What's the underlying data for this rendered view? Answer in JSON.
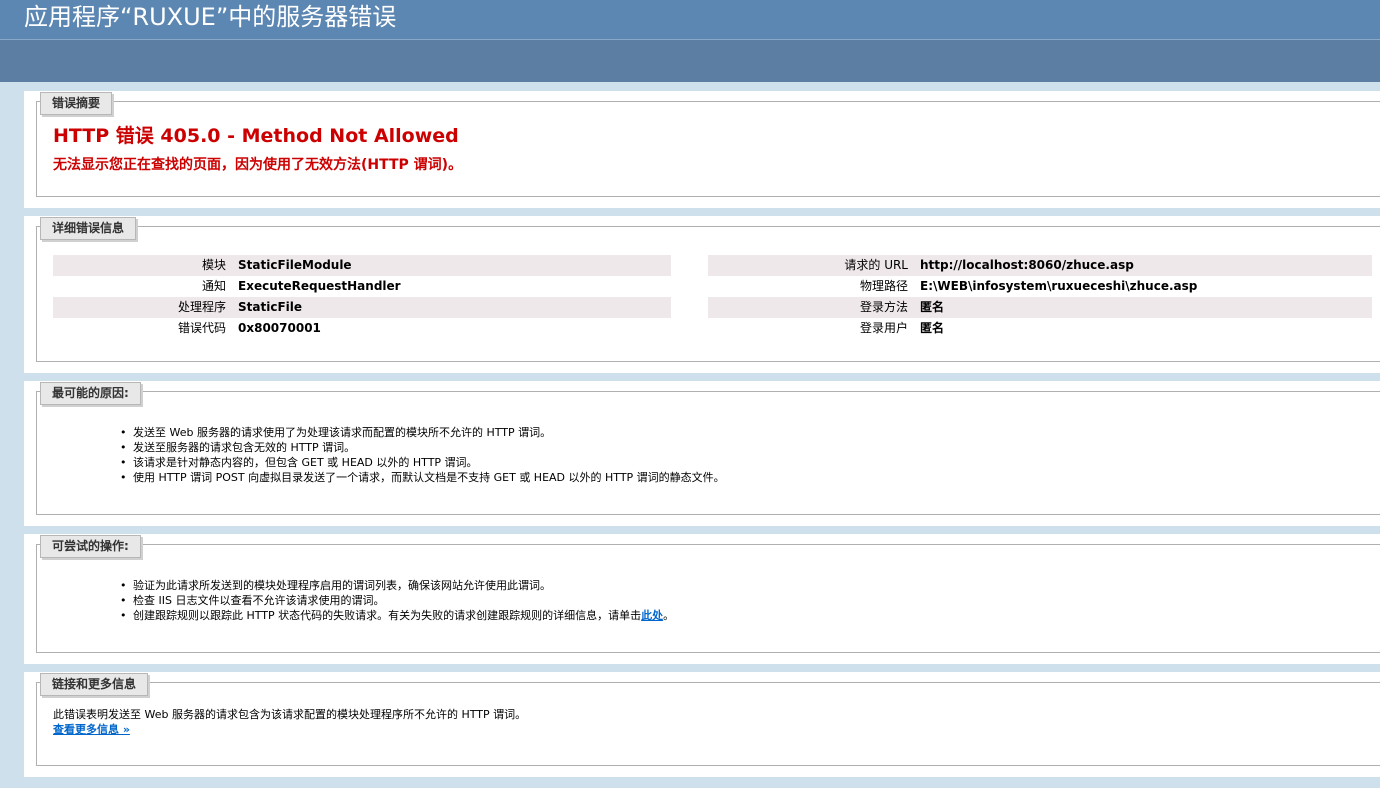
{
  "header": {
    "title": "应用程序“RUXUE”中的服务器错误"
  },
  "summary": {
    "legend": "错误摘要",
    "error_title": "HTTP 错误 405.0 - Method Not Allowed",
    "error_desc": "无法显示您正在查找的页面，因为使用了无效方法(HTTP 谓词)。"
  },
  "details": {
    "legend": "详细错误信息",
    "left": [
      {
        "label": "模块",
        "value": "StaticFileModule"
      },
      {
        "label": "通知",
        "value": "ExecuteRequestHandler"
      },
      {
        "label": "处理程序",
        "value": "StaticFile"
      },
      {
        "label": "错误代码",
        "value": "0x80070001"
      }
    ],
    "right": [
      {
        "label": "请求的 URL",
        "value": "http://localhost:8060/zhuce.asp"
      },
      {
        "label": "物理路径",
        "value": "E:\\WEB\\infosystem\\ruxueceshi\\zhuce.asp"
      },
      {
        "label": "登录方法",
        "value": "匿名"
      },
      {
        "label": "登录用户",
        "value": "匿名"
      }
    ]
  },
  "causes": {
    "legend": "最可能的原因:",
    "items": [
      "发送至 Web 服务器的请求使用了为处理该请求而配置的模块所不允许的 HTTP 谓词。",
      "发送至服务器的请求包含无效的 HTTP 谓词。",
      "该请求是针对静态内容的，但包含 GET 或 HEAD 以外的 HTTP 谓词。",
      "使用 HTTP 谓词 POST 向虚拟目录发送了一个请求，而默认文档是不支持 GET 或 HEAD 以外的 HTTP 谓词的静态文件。"
    ]
  },
  "actions": {
    "legend": "可尝试的操作:",
    "items": [
      "验证为此请求所发送到的模块处理程序启用的谓词列表，确保该网站允许使用此谓词。",
      "检查 IIS 日志文件以查看不允许该请求使用的谓词。"
    ],
    "last_item_text": "创建跟踪规则以跟踪此 HTTP 状态代码的失败请求。有关为失败的请求创建跟踪规则的详细信息，请单击",
    "last_item_link": "此处",
    "last_item_end": "。"
  },
  "links": {
    "legend": "链接和更多信息",
    "text": "此错误表明发送至 Web 服务器的请求包含为该请求配置的模块处理程序所不允许的 HTTP 谓词。",
    "more_link": "查看更多信息 »"
  },
  "icons": {
    "bullet": "•"
  },
  "colors": {
    "header_bg": "#5c87b2",
    "error_red": "#cc0000",
    "link_blue": "#0066cc"
  }
}
